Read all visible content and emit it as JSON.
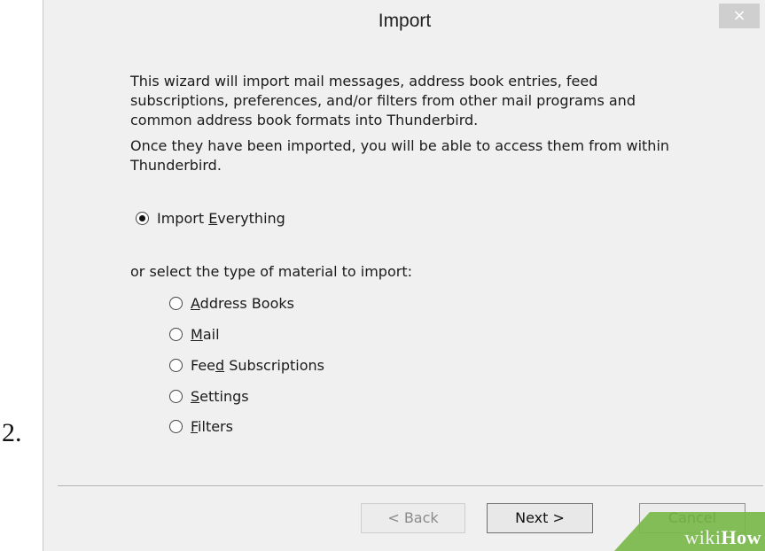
{
  "step_number": "2.",
  "dialog": {
    "title": "Import",
    "close_glyph": "×",
    "intro_text": "This wizard will import mail messages, address book entries, feed subscriptions, preferences, and/or filters from other mail programs and common address book formats into Thunderbird.",
    "access_text": "Once they have been imported, you will be able to access them from within Thunderbird.",
    "import_everything": {
      "pre": "Import ",
      "accel": "E",
      "post": "verything",
      "checked": true
    },
    "select_type_label": "or select the type of material to import:",
    "options": [
      {
        "pre": "",
        "accel": "A",
        "post": "ddress Books",
        "checked": false
      },
      {
        "pre": "",
        "accel": "M",
        "post": "ail",
        "checked": false
      },
      {
        "pre": "Fee",
        "accel": "d",
        "post": " Subscriptions",
        "checked": false
      },
      {
        "pre": "",
        "accel": "S",
        "post": "ettings",
        "checked": false
      },
      {
        "pre": "",
        "accel": "F",
        "post": "ilters",
        "checked": false
      }
    ],
    "buttons": {
      "back": "< Back",
      "next": "Next >",
      "cancel": "Cancel"
    }
  },
  "watermark": {
    "wiki": "wiki",
    "how": "How"
  },
  "colors": {
    "dialog_bg": "#f0f0f0",
    "watermark_green": "#7ab94a"
  }
}
